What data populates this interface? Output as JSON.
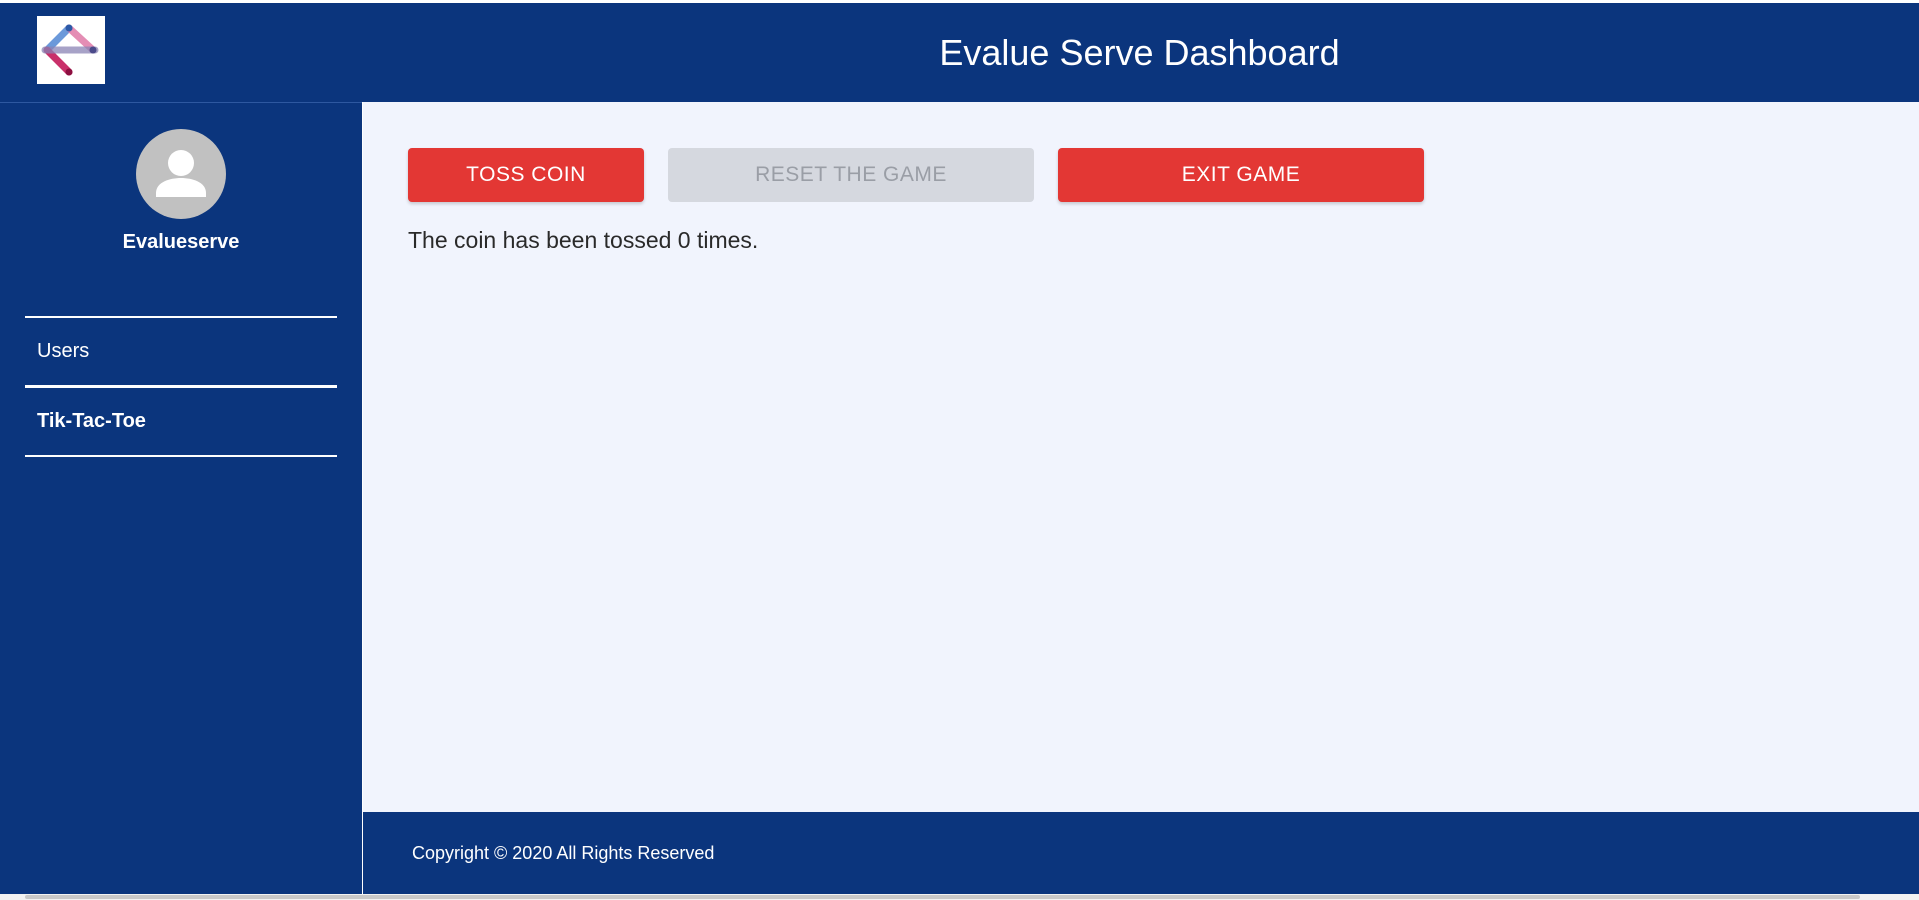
{
  "header": {
    "title": "Evalue Serve Dashboard",
    "logo": "evalueserve-logo"
  },
  "sidebar": {
    "profile": {
      "name": "Evalueserve",
      "avatar": "user-avatar-icon"
    },
    "items": [
      {
        "label": "Users"
      },
      {
        "label": "Tik-Tac-Toe"
      }
    ]
  },
  "main": {
    "buttons": {
      "toss": "TOSS COIN",
      "reset": "RESET THE GAME",
      "exit": "EXIT GAME"
    },
    "toss_message": "The coin has been tossed 0 times."
  },
  "footer": {
    "copyright": "Copyright © 2020 All Rights Reserved"
  },
  "colors": {
    "brand": "#0b357d",
    "accent_red": "#e33734",
    "disabled": "#d5d8df",
    "content_bg": "#f1f4fd"
  }
}
